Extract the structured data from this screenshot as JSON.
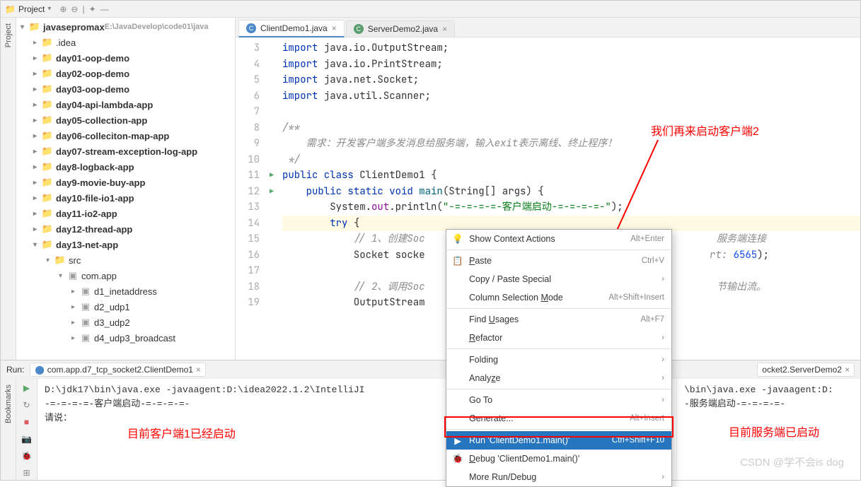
{
  "top": {
    "project_label": "Project",
    "project_icon": "project-icon"
  },
  "sidebar": {
    "root": {
      "name": "javasepromax",
      "path": "E:\\JavaDevelop\\code01\\java"
    },
    "items": [
      {
        "arrow": "▸",
        "icon": "folder-tan",
        "label": ".idea",
        "indent": 1
      },
      {
        "arrow": "▸",
        "icon": "folder-blue",
        "label": "day01-oop-demo",
        "indent": 1,
        "bold": true
      },
      {
        "arrow": "▸",
        "icon": "folder-blue",
        "label": "day02-oop-demo",
        "indent": 1,
        "bold": true
      },
      {
        "arrow": "▸",
        "icon": "folder-blue",
        "label": "day03-oop-demo",
        "indent": 1,
        "bold": true
      },
      {
        "arrow": "▸",
        "icon": "folder-blue",
        "label": "day04-api-lambda-app",
        "indent": 1,
        "bold": true
      },
      {
        "arrow": "▸",
        "icon": "folder-blue",
        "label": "day05-collection-app",
        "indent": 1,
        "bold": true
      },
      {
        "arrow": "▸",
        "icon": "folder-blue",
        "label": "day06-colleciton-map-app",
        "indent": 1,
        "bold": true
      },
      {
        "arrow": "▸",
        "icon": "folder-blue",
        "label": "day07-stream-exception-log-app",
        "indent": 1,
        "bold": true
      },
      {
        "arrow": "▸",
        "icon": "folder-blue",
        "label": "day8-logback-app",
        "indent": 1,
        "bold": true
      },
      {
        "arrow": "▸",
        "icon": "folder-blue",
        "label": "day9-movie-buy-app",
        "indent": 1,
        "bold": true
      },
      {
        "arrow": "▸",
        "icon": "folder-blue",
        "label": "day10-file-io1-app",
        "indent": 1,
        "bold": true
      },
      {
        "arrow": "▸",
        "icon": "folder-blue",
        "label": "day11-io2-app",
        "indent": 1,
        "bold": true
      },
      {
        "arrow": "▸",
        "icon": "folder-blue",
        "label": "day12-thread-app",
        "indent": 1,
        "bold": true
      },
      {
        "arrow": "▾",
        "icon": "folder-blue",
        "label": "day13-net-app",
        "indent": 1,
        "bold": true
      },
      {
        "arrow": "▾",
        "icon": "folder-blue",
        "label": "src",
        "indent": 2
      },
      {
        "arrow": "▾",
        "icon": "pkg",
        "label": "com.app",
        "indent": 3
      },
      {
        "arrow": "▸",
        "icon": "pkg",
        "label": "d1_inetaddress",
        "indent": 4
      },
      {
        "arrow": "▸",
        "icon": "pkg",
        "label": "d2_udp1",
        "indent": 4
      },
      {
        "arrow": "▸",
        "icon": "pkg",
        "label": "d3_udp2",
        "indent": 4
      },
      {
        "arrow": "▸",
        "icon": "pkg",
        "label": "d4_udp3_broadcast",
        "indent": 4
      }
    ]
  },
  "tabs": [
    {
      "icon": "C",
      "color": "blue",
      "label": "ClientDemo1.java",
      "active": true
    },
    {
      "icon": "C",
      "color": "green",
      "label": "ServerDemo2.java",
      "active": false
    }
  ],
  "code": {
    "lines": [
      3,
      4,
      5,
      6,
      7,
      8,
      9,
      10,
      11,
      12,
      13,
      14,
      15,
      16,
      17,
      18,
      19
    ],
    "run_marks": {
      "11": true,
      "12": true
    }
  },
  "code_frag": {
    "l3a": "import ",
    "l3b": "java.io.OutputStream;",
    "l4a": "import ",
    "l4b": "java.io.PrintStream;",
    "l5a": "import ",
    "l5b": "java.net.Socket;",
    "l6a": "import ",
    "l6b": "java.util.Scanner;",
    "l8": "/**",
    "l9": "    需求：开发客户端多发消息给服务端，输入exit表示离线、终止程序！",
    "l10": " */",
    "l11a": "public class ",
    "l11b": "ClientDemo1 {",
    "l12a": "    public static void ",
    "l12b": "main",
    "l12c": "(String[] args) {",
    "l13a": "        System.",
    "l13b": "out",
    "l13c": ".println(",
    "l13d": "\"-=-=-=-=-客户端启动-=-=-=-=-\"",
    "l13e": ");",
    "l14a": "        try ",
    "l14b": "{",
    "l15": "            // 1、创建Soc",
    "l15b": "服务端连接",
    "l16a": "            Socket socke",
    "l16b": "rt: ",
    "l16c": "6565",
    "l16d": ");",
    "l17": "",
    "l18": "            // 2、调用Soc",
    "l18b": "节输出流。",
    "l19": "            OutputStream"
  },
  "context_menu": {
    "items": [
      {
        "icon": "💡",
        "label": "Show Context Actions",
        "shortcut": "Alt+Enter"
      },
      {
        "sep": true
      },
      {
        "icon": "📋",
        "label_pre": "",
        "u": "P",
        "label_post": "aste",
        "shortcut": "Ctrl+V"
      },
      {
        "label": "Copy / Paste Special",
        "sub": true
      },
      {
        "label_pre": "Column Selection ",
        "u": "M",
        "label_post": "ode",
        "shortcut": "Alt+Shift+Insert"
      },
      {
        "sep": true
      },
      {
        "label_pre": "Find ",
        "u": "U",
        "label_post": "sages",
        "shortcut": "Alt+F7"
      },
      {
        "label_pre": "",
        "u": "R",
        "label_post": "efactor",
        "sub": true
      },
      {
        "sep": true
      },
      {
        "label": "Folding",
        "sub": true
      },
      {
        "label_pre": "Analy",
        "u": "z",
        "label_post": "e",
        "sub": true
      },
      {
        "sep": true
      },
      {
        "label": "Go To",
        "sub": true
      },
      {
        "label": "Generate...",
        "shortcut": "Alt+Insert"
      },
      {
        "sep": true
      },
      {
        "icon": "▶",
        "sel": true,
        "label": "Run 'ClientDemo1.main()'",
        "shortcut": "Ctrl+Shift+F10"
      },
      {
        "icon": "🐞",
        "label_pre": "",
        "u": "D",
        "label_post": "ebug 'ClientDemo1.main()'"
      },
      {
        "label": "More Run/Debug",
        "sub": true
      }
    ]
  },
  "run": {
    "label": "Run:",
    "tab1": "com.app.d7_tcp_socket2.ClientDemo1",
    "tab2": "ocket2.ServerDemo2",
    "console1": {
      "line1": "D:\\jdk17\\bin\\java.exe -javaagent:D:\\idea2022.1.2\\IntelliJI",
      "line2": "-=-=-=-=-客户端启动-=-=-=-=-",
      "line3": "请说："
    },
    "console2": {
      "line1": "\\bin\\java.exe -javaagent:D:",
      "line2": "-服务端启动-=-=-=-=-"
    }
  },
  "annotations": {
    "a1": "目前客户端1已经启动",
    "a2": "目前服务端已启动",
    "a3": "我们再来启动客户端2"
  },
  "left_labels": {
    "project": "Project",
    "bookmarks": "Bookmarks"
  },
  "watermark": "CSDN @学不会is dog"
}
